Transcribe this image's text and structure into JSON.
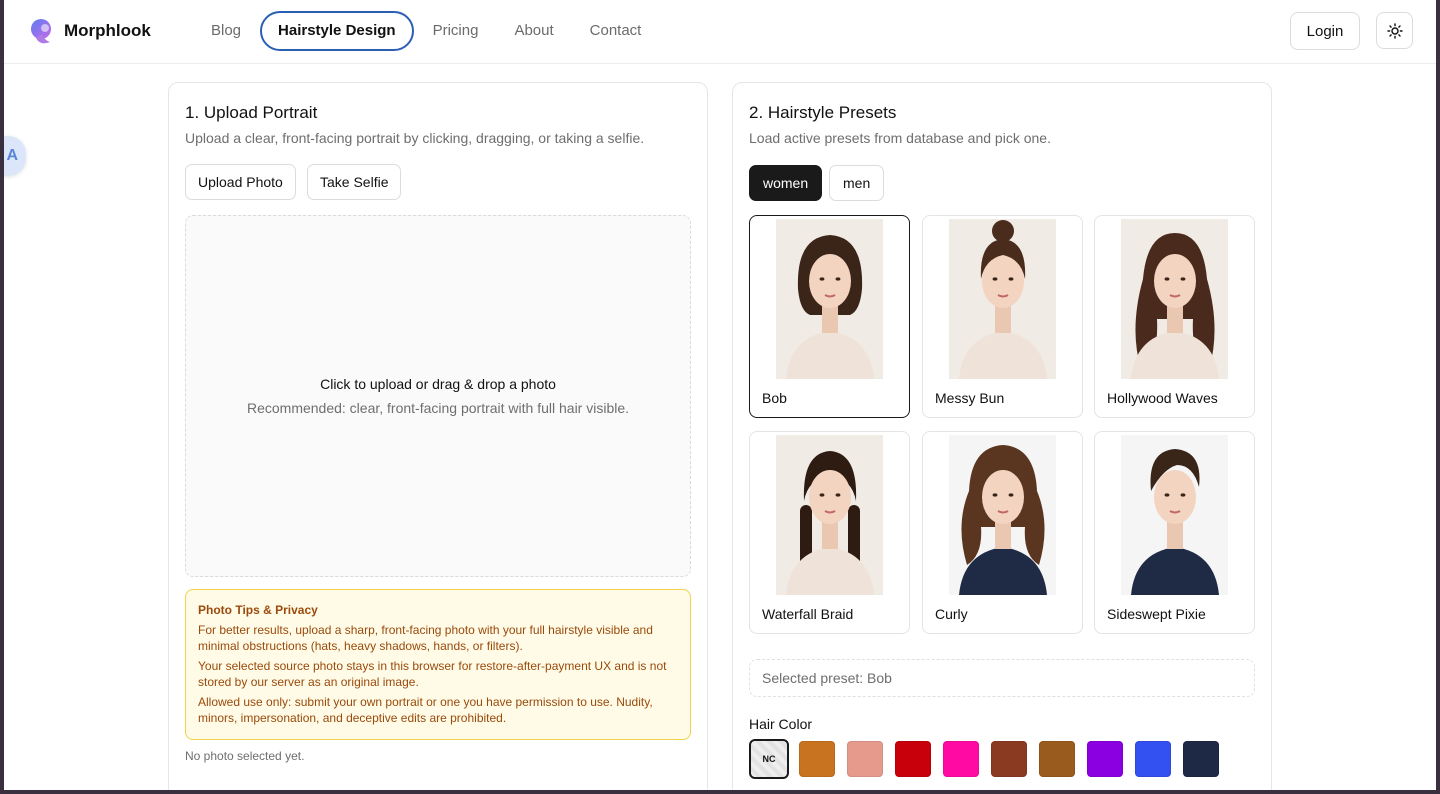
{
  "header": {
    "brand": "Morphlook",
    "nav": [
      "Blog",
      "Hairstyle Design",
      "Pricing",
      "About",
      "Contact"
    ],
    "active_nav": "Hairstyle Design",
    "login_label": "Login"
  },
  "upload": {
    "title": "1. Upload Portrait",
    "subtitle": "Upload a clear, front-facing portrait by clicking, dragging, or taking a selfie.",
    "upload_button": "Upload Photo",
    "selfie_button": "Take Selfie",
    "dropzone_main": "Click to upload or drag & drop a photo",
    "dropzone_sub": "Recommended: clear, front-facing portrait with full hair visible.",
    "tips_title": "Photo Tips & Privacy",
    "tips": [
      "For better results, upload a sharp, front-facing photo with your full hairstyle visible and minimal obstructions (hats, heavy shadows, hands, or filters).",
      "Your selected source photo stays in this browser for restore-after-payment UX and is not stored by our server as an original image.",
      "Allowed use only: submit your own portrait or one you have permission to use. Nudity, minors, impersonation, and deceptive edits are prohibited."
    ],
    "status": "No photo selected yet."
  },
  "presets": {
    "title": "2. Hairstyle Presets",
    "subtitle": "Load active presets from database and pick one.",
    "tabs": [
      "women",
      "men"
    ],
    "active_tab": "women",
    "items": [
      {
        "label": "Bob",
        "hair": "#3b2418",
        "style": "bob",
        "selected": true
      },
      {
        "label": "Messy Bun",
        "hair": "#4a2c1c",
        "style": "bun",
        "selected": false
      },
      {
        "label": "Hollywood Waves",
        "hair": "#4a2a1d",
        "style": "waves",
        "selected": false
      },
      {
        "label": "Waterfall Braid",
        "hair": "#2e1c13",
        "style": "braid",
        "selected": false
      },
      {
        "label": "Curly",
        "hair": "#5a3621",
        "style": "curly",
        "selected": false
      },
      {
        "label": "Sideswept Pixie",
        "hair": "#3a2519",
        "style": "pixie",
        "selected": false
      }
    ],
    "selected_text": "Selected preset: Bob",
    "hair_color_label": "Hair Color",
    "nc_label": "NC",
    "colors": [
      "#c8731f",
      "#e69a8c",
      "#c8000b",
      "#ff0aa2",
      "#8b3a22",
      "#9a5b1e",
      "#8a00e0",
      "#3350f0",
      "#1e2946"
    ]
  }
}
